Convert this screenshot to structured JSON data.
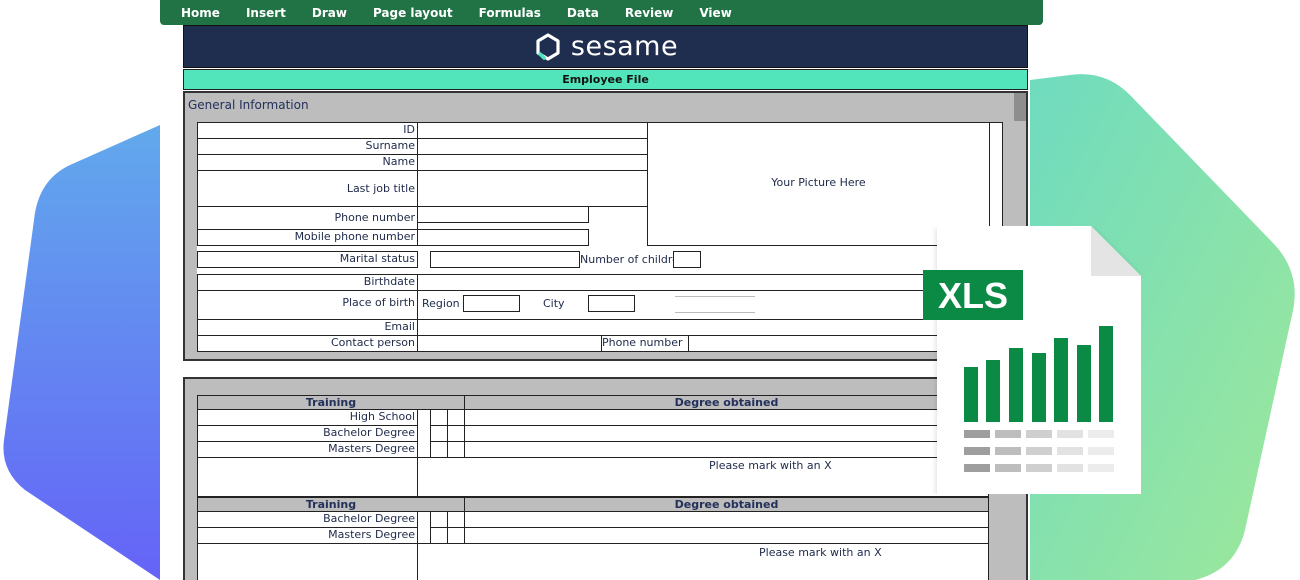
{
  "ribbon": {
    "tabs": [
      "Home",
      "Insert",
      "Draw",
      "Page layout",
      "Formulas",
      "Data",
      "Review",
      "View"
    ]
  },
  "brand": {
    "name": "sesame"
  },
  "sheet": {
    "title": "Employee File",
    "section": "General Information",
    "fields": {
      "id": "ID",
      "surname": "Surname",
      "name": "Name",
      "last_job_title": "Last job title",
      "phone_number": "Phone number",
      "mobile_phone_number": "Mobile phone number",
      "marital_status": "Marital status",
      "number_of_children": "Number of children",
      "birthdate": "Birthdate",
      "place_of_birth": "Place of birth",
      "region": "Region",
      "city": "City",
      "email": "Email",
      "contact_person": "Contact person",
      "contact_phone_number": "Phone number"
    },
    "picture_placeholder": "Your Picture Here",
    "training1": {
      "header_training": "Training",
      "header_degree": "Degree obtained",
      "rows": [
        "High School",
        "Bachelor Degree",
        "Masters Degree"
      ],
      "note": "Please mark with an X"
    },
    "training2": {
      "header_training": "Training",
      "header_degree": "Degree obtained",
      "rows": [
        "Bachelor Degree",
        "Masters Degree"
      ],
      "note": "Please mark with an X"
    }
  },
  "file_icon": {
    "label": "XLS",
    "colors": {
      "green": "#0b8a45",
      "accent": "#217346"
    }
  },
  "colors": {
    "ribbon": "#217346",
    "navy": "#1f2d4f",
    "mint": "#52e5bb",
    "panel": "#bdbdbd"
  }
}
